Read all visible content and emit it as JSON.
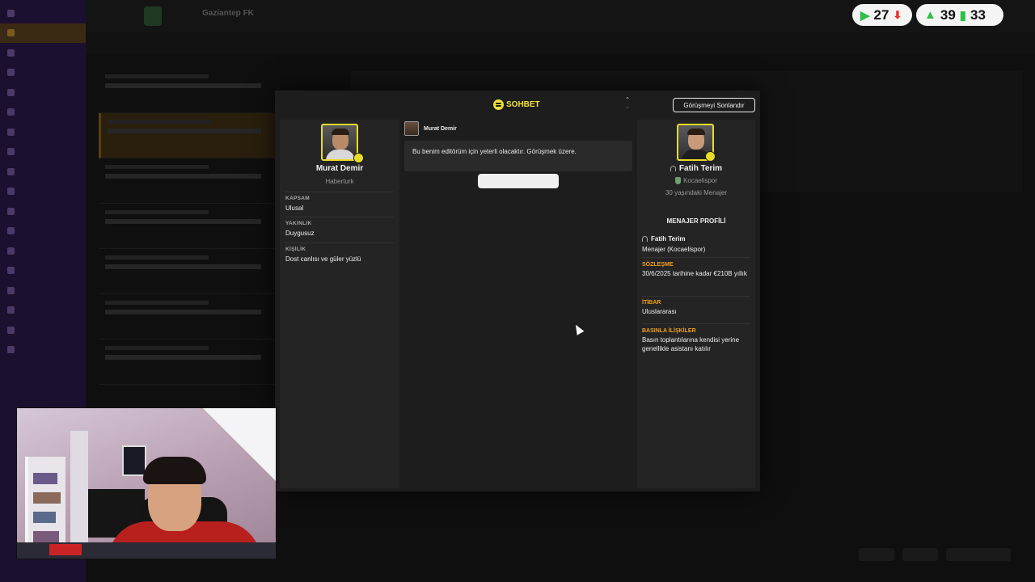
{
  "background_app": {
    "club_name": "Gaziantep FK",
    "club_subtitle": "",
    "subnav_tabs": [
      "",
      "",
      "",
      "",
      "",
      ""
    ],
    "sidebar_items": [
      "",
      "",
      "",
      "",
      "",
      "",
      "",
      "",
      "",
      "",
      "",
      "",
      "",
      "",
      "",
      "",
      "",
      "",
      ""
    ]
  },
  "hud": {
    "pill1_value": "27",
    "pill2_value1": "39",
    "pill2_value2": "33"
  },
  "chat": {
    "title": "SOHBET",
    "end_button_label": "Görüşmeyi Sonlandır",
    "journalist": {
      "name": "Murat Demir",
      "outlet": "Haberturk",
      "attributes": [
        {
          "key": "KAPSAM",
          "value": "Ulusal"
        },
        {
          "key": "YAKINLIK",
          "value": "Duygusuz"
        },
        {
          "key": "KİŞİLİK",
          "value": "Dost canlısı ve güler yüzlü"
        }
      ]
    },
    "message": {
      "author": "Murat Demir",
      "text": "Bu benim editörüm için yeterli olacaktır. Görüşmek üzere."
    },
    "manager": {
      "name": "Fatih Terim",
      "club": "Kocaelispor",
      "description": "30 yaşındaki Menajer",
      "profile_title": "MENAJER PROFİLİ",
      "profile_name": "Fatih Terim",
      "profile_role": "Menajer (Kocaelispor)",
      "sections": [
        {
          "key": "SÖZLEŞME",
          "value": "30/6/2025 tarihine kadar €210B yıllık"
        },
        {
          "key": "İTİBAR",
          "value": "Uluslararası"
        },
        {
          "key": "BASINLA İLİŞKİLER",
          "value": "Basın toplantılarına kendisi yerine genellikle asistanı katılır"
        }
      ]
    }
  },
  "colors": {
    "accent_yellow": "#f1e33a",
    "section_orange": "#f0a020",
    "hud_green": "#2fbf4a",
    "hud_red": "#e33333"
  }
}
